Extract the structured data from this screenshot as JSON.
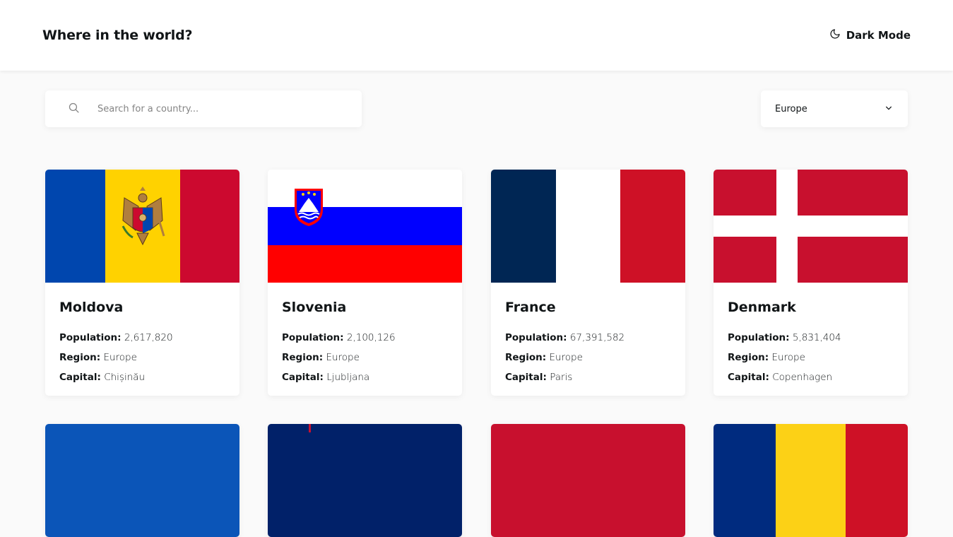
{
  "header": {
    "title": "Where in the world?",
    "dark_mode_label": "Dark Mode"
  },
  "search": {
    "placeholder": "Search for a country..."
  },
  "filter": {
    "selected": "Europe"
  },
  "labels": {
    "population": "Population:",
    "region": "Region:",
    "capital": "Capital:"
  },
  "countries": [
    {
      "name": "Moldova",
      "population": "2,617,820",
      "region": "Europe",
      "capital": "Chișinău"
    },
    {
      "name": "Slovenia",
      "population": "2,100,126",
      "region": "Europe",
      "capital": "Ljubljana"
    },
    {
      "name": "France",
      "population": "67,391,582",
      "region": "Europe",
      "capital": "Paris"
    },
    {
      "name": "Denmark",
      "population": "5,831,404",
      "region": "Europe",
      "capital": "Copenhagen"
    }
  ],
  "colors": {
    "background": "#fafafa",
    "element": "#ffffff",
    "text": "#111517",
    "placeholder": "#848484"
  },
  "icons": {
    "dark_mode": "moon-icon",
    "search": "search-icon",
    "filter": "chevron-down-icon"
  }
}
